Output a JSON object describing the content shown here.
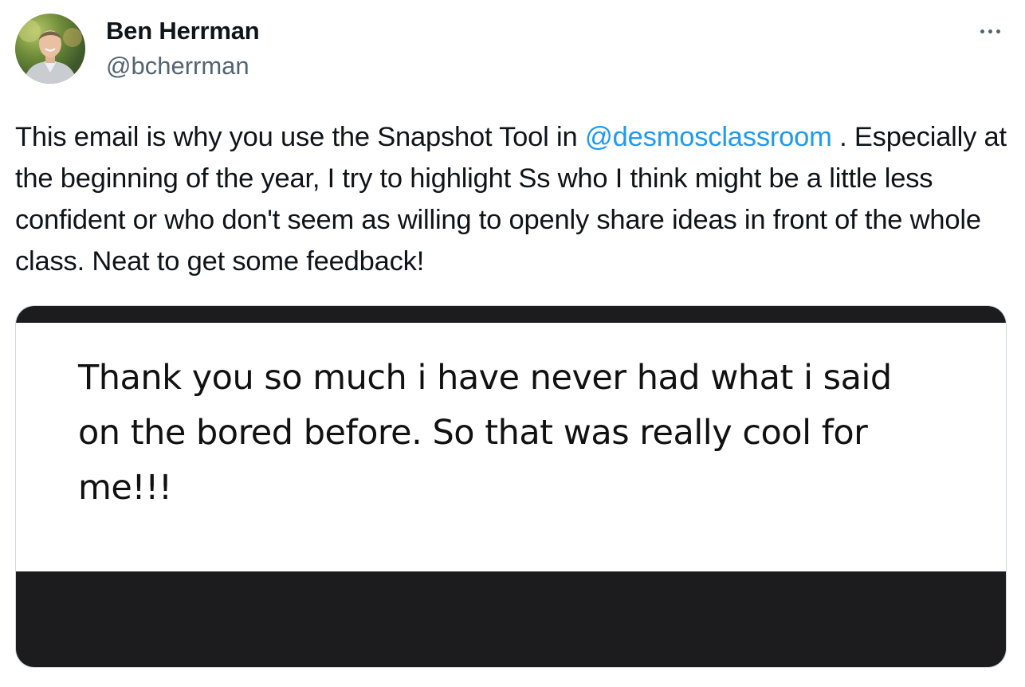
{
  "author": {
    "name": "Ben Herrman",
    "handle": "@bcherrman",
    "avatar_icon": "profile-photo"
  },
  "more_menu": {
    "icon": "more-horizontal-icon"
  },
  "tweet": {
    "text_before_mention": "This email is why you use the Snapshot Tool in ",
    "mention": "@desmosclassroom",
    "text_after_mention": " . Especially at the beginning of the year, I try to highlight Ss who I think might be a little less confident or who don't seem as willing to openly share ideas in front of the whole class. Neat to get some feedback!"
  },
  "media": {
    "message": "Thank you so much i have never had what i said on the bored before. So that was really cool for me!!!"
  },
  "colors": {
    "link": "#1d9bf0",
    "secondary_text": "#536471",
    "border": "#cfd9de",
    "media_dark": "#1c1c1e"
  }
}
